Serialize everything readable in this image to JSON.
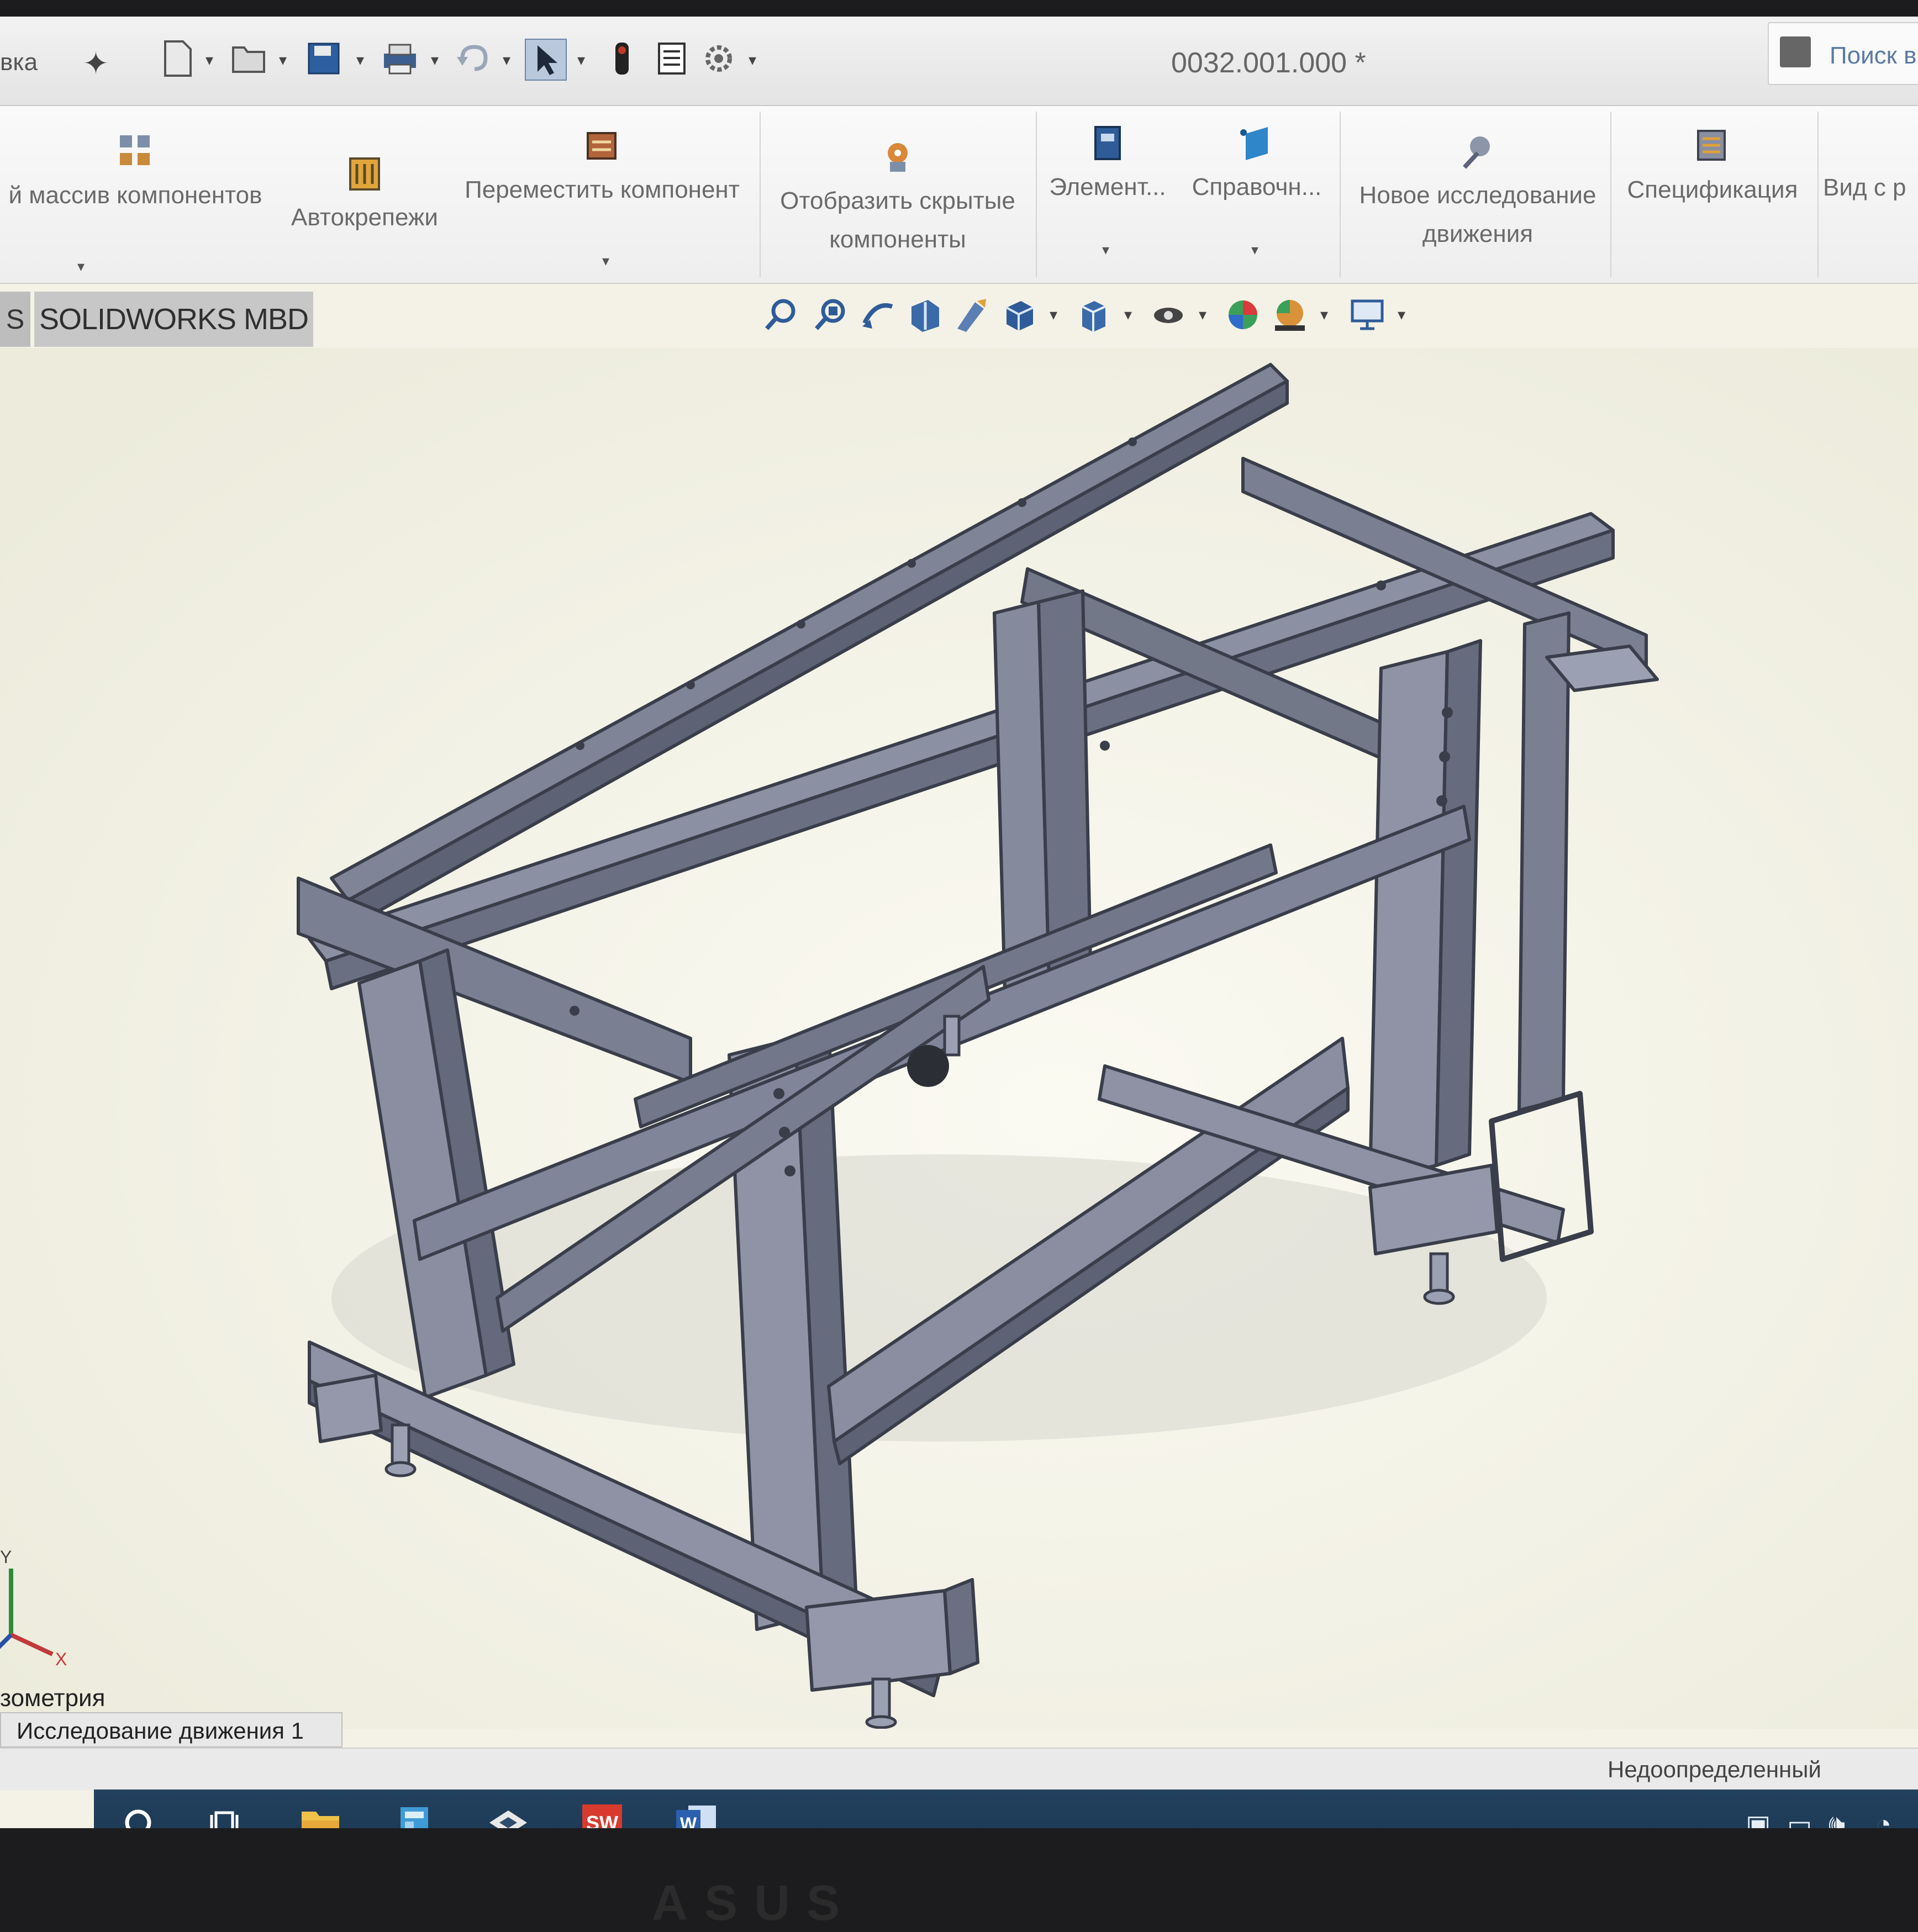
{
  "quick_access": {
    "left_text": "вка",
    "document_title": "0032.001.000 *",
    "search_label": "Поиск в"
  },
  "ribbon": {
    "pattern_label": "й массив компонентов",
    "autofasteners_label": "Автокрепежи",
    "move_component_label": "Переместить компонент",
    "show_hidden_line1": "Отобразить скрытые",
    "show_hidden_line2": "компоненты",
    "element_label": "Элемент...",
    "reference_label": "Справочн...",
    "motion_study_line1": "Новое исследование",
    "motion_study_line2": "движения",
    "bom_label": "Спецификация",
    "view_label": "Вид с р"
  },
  "tabs": {
    "partial_tab": "S",
    "mbd_tab": "SOLIDWORKS MBD"
  },
  "viewport": {
    "view_name": "зометрия",
    "triad_x": "X",
    "triad_y": "Y"
  },
  "bottom": {
    "motion_study_tab": "Исследование движения 1",
    "status": "Недоопределенный"
  },
  "taskbar": {
    "sw_icon_text": "SW",
    "word_icon_text": "W"
  },
  "colors": {
    "model_steel": "#8a8ea0",
    "model_edge": "#3a3d4a",
    "background": "#f4f2e6",
    "taskbar": "#1f3c58"
  }
}
